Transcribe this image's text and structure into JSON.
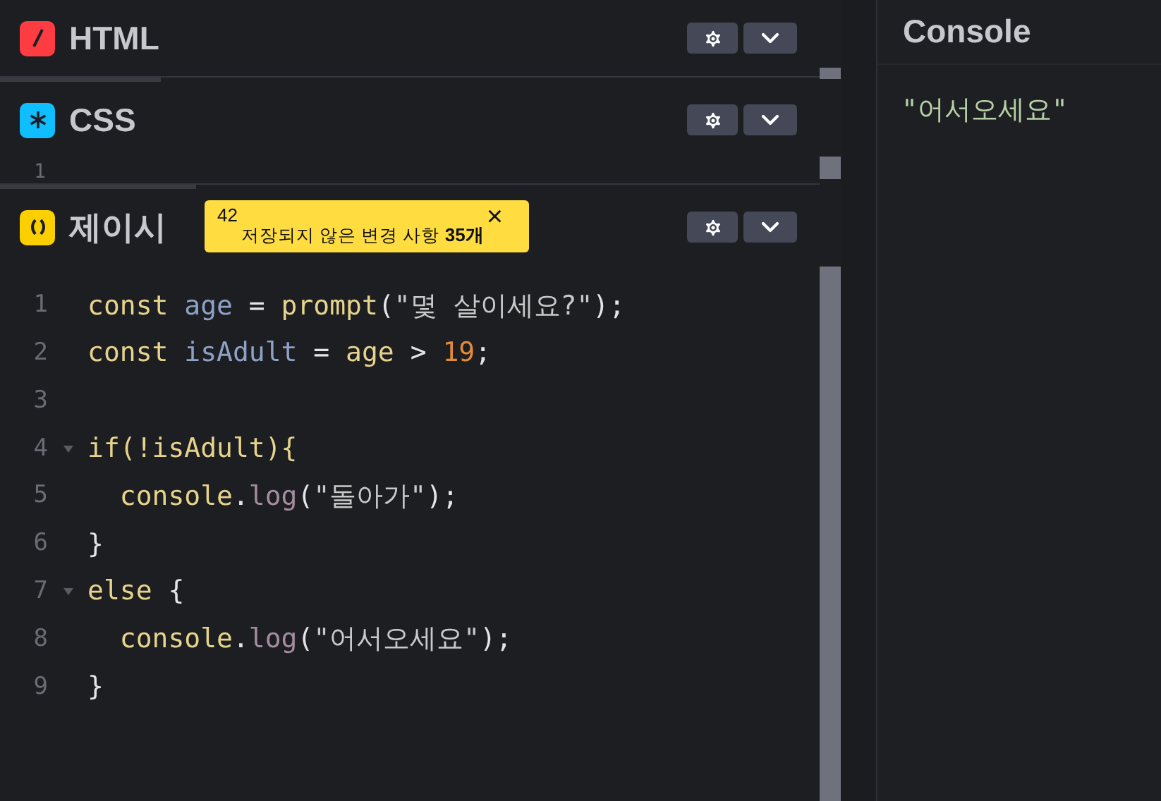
{
  "panels": [
    {
      "kind": "html",
      "title": "HTML"
    },
    {
      "kind": "css",
      "title": "CSS",
      "gutter": "1"
    },
    {
      "kind": "js",
      "title": "제이시"
    }
  ],
  "toast": {
    "count": "42",
    "message": "저장되지 않은 변경 사항",
    "suffix": "35개",
    "close": "×"
  },
  "code": [
    {
      "number": "1",
      "foldable": false,
      "tokens": [
        {
          "kind": "keyword",
          "text": "const "
        },
        {
          "kind": "variable",
          "text": "age"
        },
        {
          "kind": "plain",
          "text": " = "
        },
        {
          "kind": "keyword",
          "text": "prompt"
        },
        {
          "kind": "plain",
          "text": "("
        },
        {
          "kind": "string",
          "text": "\"몇 살이세요?\""
        },
        {
          "kind": "plain",
          "text": ");"
        }
      ]
    },
    {
      "number": "2",
      "foldable": false,
      "tokens": [
        {
          "kind": "keyword",
          "text": "const "
        },
        {
          "kind": "variable",
          "text": "isAdult"
        },
        {
          "kind": "plain",
          "text": " = "
        },
        {
          "kind": "keyword",
          "text": "age"
        },
        {
          "kind": "plain",
          "text": " > "
        },
        {
          "kind": "number",
          "text": "19"
        },
        {
          "kind": "plain",
          "text": ";"
        }
      ]
    },
    {
      "number": "3",
      "foldable": false
    },
    {
      "number": "4",
      "foldable": true,
      "tokens": [
        {
          "kind": "keyword",
          "text": "if(!isAdult){"
        }
      ]
    },
    {
      "number": "5",
      "foldable": false,
      "tokens": [
        {
          "kind": "keyword",
          "text": "  console"
        },
        {
          "kind": "plain",
          "text": "."
        },
        {
          "kind": "method",
          "text": "log"
        },
        {
          "kind": "plain",
          "text": "("
        },
        {
          "kind": "string",
          "text": "\"돌아가\""
        },
        {
          "kind": "plain",
          "text": ");"
        }
      ]
    },
    {
      "number": "6",
      "foldable": false,
      "tokens": [
        {
          "kind": "plain",
          "text": "}"
        }
      ]
    },
    {
      "number": "7",
      "foldable": true,
      "tokens": [
        {
          "kind": "keyword",
          "text": "else "
        },
        {
          "kind": "plain",
          "text": "{"
        }
      ]
    },
    {
      "number": "8",
      "foldable": false,
      "tokens": [
        {
          "kind": "keyword",
          "text": "  console"
        },
        {
          "kind": "plain",
          "text": "."
        },
        {
          "kind": "method",
          "text": "log"
        },
        {
          "kind": "plain",
          "text": "("
        },
        {
          "kind": "string",
          "text": "\"어서오세요\""
        },
        {
          "kind": "plain",
          "text": ");"
        }
      ]
    },
    {
      "number": "9",
      "foldable": false,
      "tokens": [
        {
          "kind": "plain",
          "text": "}"
        }
      ]
    }
  ],
  "console": {
    "title": "Console",
    "output": "\"어서오세요\""
  }
}
